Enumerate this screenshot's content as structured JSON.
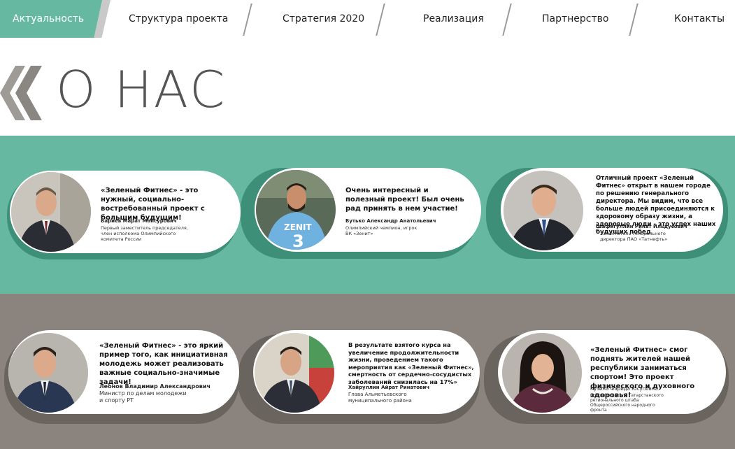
{
  "nav": {
    "items": [
      "Актуальность",
      "Структура проекта",
      "Стратегия 2020",
      "Реализация",
      "Партнерство",
      "Контакты"
    ],
    "active": "Актуальность"
  },
  "page_title": "О НАС",
  "colors": {
    "accent_green": "#66b9a0",
    "band_gray": "#8a837e",
    "title_gray": "#555555"
  },
  "testimonials": [
    {
      "quote": "«Зеленый Фитнес» - это нужный, социально-востребованный проект с большим будущим!",
      "name": "Бариев Марат Мансурович",
      "role": "Первый заместитель председателя, член исполкома Олимпийского комитета России"
    },
    {
      "quote": "Очень интересный и полезный проект! Был очень рад принять в нем участие!",
      "name": "Бутько Александр Анатольевич",
      "role": "Олимпийский чемпион, игрок ВК «Зенит»"
    },
    {
      "quote": "Отличный проект «Зеленый Фитнес» открыт в нашем городе по решению генерального директора. Мы видим, что все больше людей присоединяются к здоровому образу жизни, а здоровые люди - это успех наших будущих побед",
      "name": "Шафигуллин Ринат Ильдусович",
      "role": "Заместитель генерального директора ПАО «Татнефть»"
    },
    {
      "quote": "«Зеленый Фитнес» - это яркий пример того, как инициативная молодежь может реализовать важные социально-значимые задачи!",
      "name": "Леонов Владимир Александрович",
      "role": "Министр по делам молодежи и спорту РТ"
    },
    {
      "quote": "В результате взятого курса на увеличение продолжительности жизни, проведением такого мероприятия как «Зеленый Фитнес», смертность от сердечно-сосудистых заболеваний снизилась на 17%»",
      "name": "Хайруллин Айрат Ринатович",
      "role": "Глава Альметьевского муниципального района"
    },
    {
      "quote": "«Зеленый Фитнес» смог поднять жителей нашей республики заниматься спортом! Это проект физического и духовного здоровья!",
      "name": "Кузина Фарида Юсуповна",
      "role": "Сопредседатель Татарстанского регионального штаба Общероссийского народного фронта"
    }
  ]
}
